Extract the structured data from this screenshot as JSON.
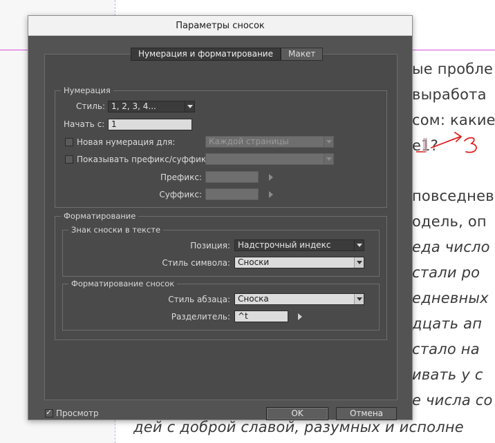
{
  "document": {
    "lines": [
      "ые пробле",
      "выработа",
      "сом: какие",
      "е1?",
      "повседнев",
      "одель, оп",
      "еда число",
      "стали ро",
      "едневных",
      "дцать ап",
      "стало на",
      "ивать у с",
      "е числа со",
      "дей с доброй славой, разумных и исполне"
    ]
  },
  "dialog": {
    "title": "Параметры сносок",
    "tabs": [
      {
        "label": "Нумерация и форматирование",
        "active": true
      },
      {
        "label": "Макет",
        "active": false
      }
    ],
    "numbering": {
      "title": "Нумерация",
      "style_label": "Стиль:",
      "style_value": "1, 2, 3, 4...",
      "start_label": "Начать с:",
      "start_value": "1",
      "restart_label": "Новая нумерация для:",
      "restart_checked": false,
      "restart_value": "Каждой страницы",
      "prefix_suffix_label": "Показывать префикс/суффикс:",
      "prefix_suffix_checked": false,
      "prefix_suffix_value": "",
      "prefix_label": "Префикс:",
      "prefix_value": "",
      "suffix_label": "Суффикс:",
      "suffix_value": ""
    },
    "formatting": {
      "title": "Форматирование",
      "marker": {
        "title": "Знак сноски в тексте",
        "position_label": "Позиция:",
        "position_value": "Надстрочный индекс",
        "char_style_label": "Стиль символа:",
        "char_style_value": "Сноски"
      },
      "footnote": {
        "title": "Форматирование сносок",
        "para_style_label": "Стиль абзаца:",
        "para_style_value": "Сноска",
        "separator_label": "Разделитель:",
        "separator_value": "^t"
      }
    },
    "preview_label": "Просмотр",
    "preview_checked": true,
    "ok_label": "OK",
    "cancel_label": "Отмена"
  }
}
